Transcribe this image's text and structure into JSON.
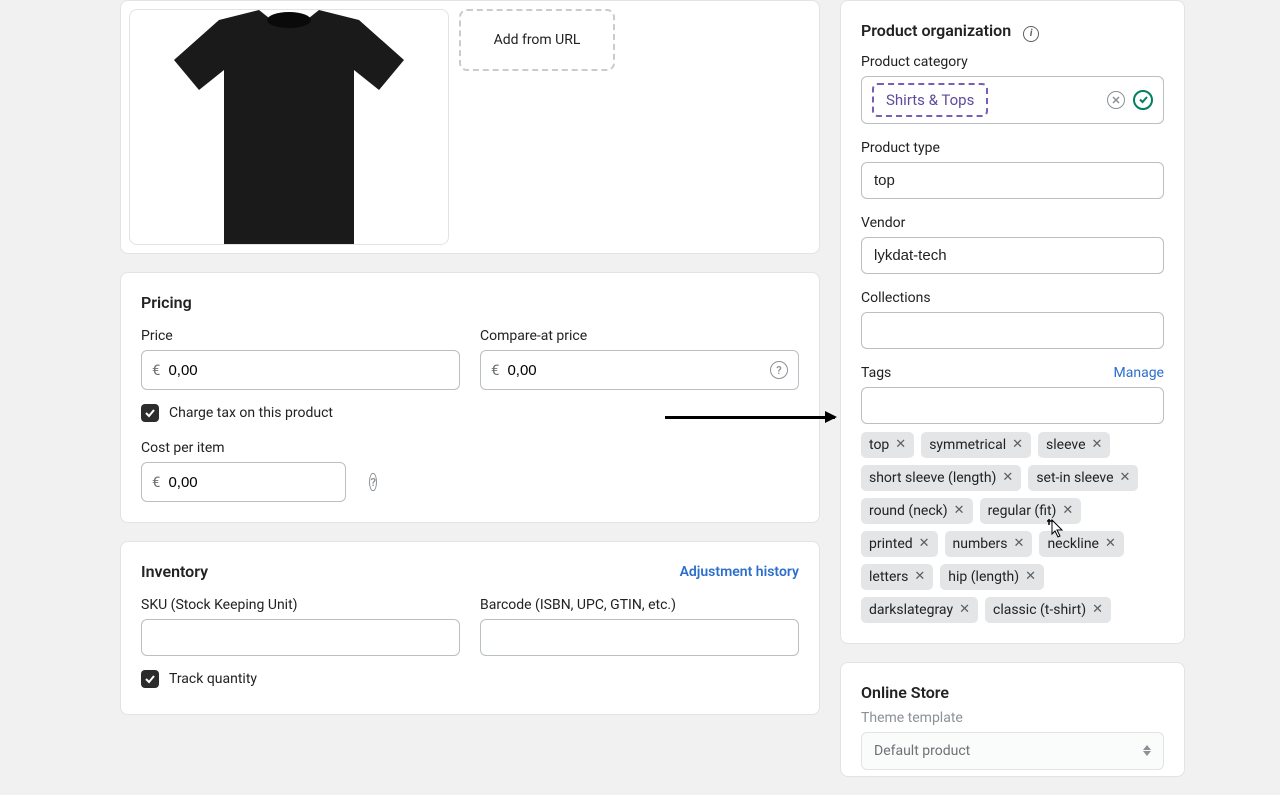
{
  "media": {
    "add_from_url": "Add from URL"
  },
  "pricing": {
    "title": "Pricing",
    "price_label": "Price",
    "price_value": "0,00",
    "compare_label": "Compare-at price",
    "compare_value": "0,00",
    "currency": "€",
    "charge_tax": "Charge tax on this product",
    "cost_label": "Cost per item",
    "cost_value": "0,00"
  },
  "inventory": {
    "title": "Inventory",
    "adjust_link": "Adjustment history",
    "sku_label": "SKU (Stock Keeping Unit)",
    "barcode_label": "Barcode (ISBN, UPC, GTIN, etc.)",
    "track_quantity": "Track quantity"
  },
  "organization": {
    "title": "Product organization",
    "category_label": "Product category",
    "category_value": "Shirts & Tops",
    "type_label": "Product type",
    "type_value": "top",
    "vendor_label": "Vendor",
    "vendor_value": "lykdat-tech",
    "collections_label": "Collections",
    "tags_label": "Tags",
    "manage_link": "Manage",
    "tags": [
      "top",
      "symmetrical",
      "sleeve",
      "short sleeve (length)",
      "set-in sleeve",
      "round (neck)",
      "regular (fit)",
      "printed",
      "numbers",
      "neckline",
      "letters",
      "hip (length)",
      "darkslategray",
      "classic (t-shirt)"
    ]
  },
  "online_store": {
    "title": "Online Store",
    "theme_label": "Theme template",
    "theme_value": "Default product"
  }
}
